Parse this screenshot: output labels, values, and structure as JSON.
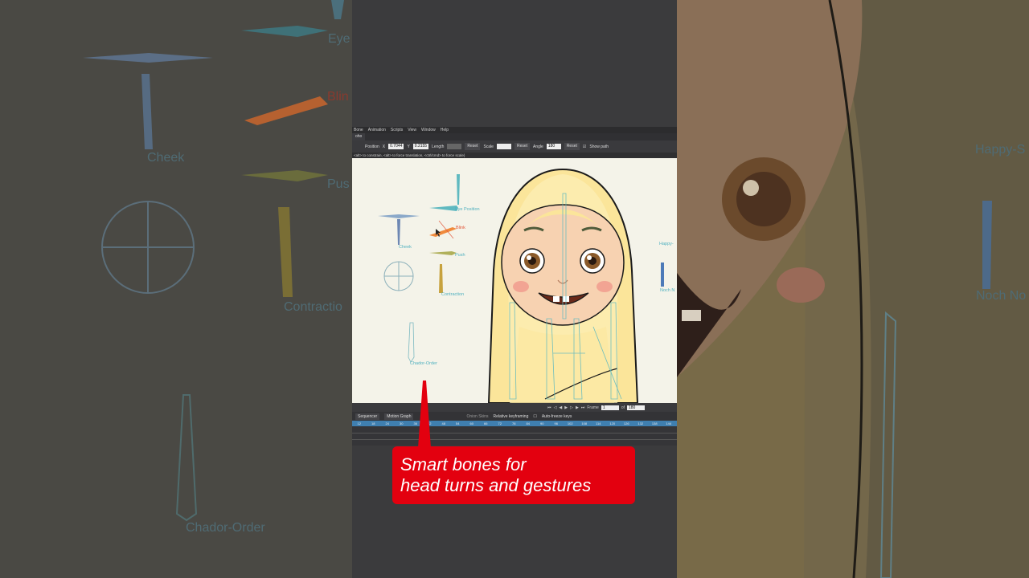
{
  "menu": [
    "Bone",
    "Animation",
    "Scripts",
    "View",
    "Window",
    "Help"
  ],
  "tab": "oho",
  "toolbar": {
    "position_label": "Position",
    "x_label": "X",
    "x_value": "0.7044",
    "y_label": "Y",
    "y_value": "0.2155",
    "length_label": "Length",
    "reset1": "Reset",
    "scale_label": "Scale",
    "reset2": "Reset",
    "angle_label": "Angle",
    "angle_value": "180",
    "reset3": "Reset",
    "show_path": "Show path"
  },
  "hint": "<alt> to constrain, <alt> to force translation, <ctrl/cmd> to force scale)",
  "bones": {
    "eye_position": "Eye Position",
    "blink": "Blink",
    "cheek": "Cheek",
    "push": "Push",
    "contraction": "Contraction",
    "chador_order": "Chador-Order",
    "happy": "Happy-",
    "noch": "Noch N"
  },
  "bg_left": {
    "eye": "Eye",
    "blink": "Blin",
    "cheek": "Cheek",
    "push": "Pus",
    "contraction": "Contractio",
    "chador": "Chador-Order"
  },
  "bg_right": {
    "happy": "Happy-S",
    "noch": "Noch No"
  },
  "playback": {
    "frame_label": "Frame",
    "frame_value": "1",
    "of_label": "of",
    "total": "180"
  },
  "timeline": {
    "sequencer": "Sequencer",
    "motion_graph": "Motion Graph",
    "dropdown": "Onion Skins",
    "relative": "Relative keyframing",
    "auto_freeze": "Auto-freeze keys",
    "ruler": [
      "12",
      "18",
      "24",
      "30",
      "36",
      "42",
      "48",
      "54",
      "60",
      "66",
      "72",
      "78",
      "84",
      "90",
      "96",
      "102",
      "108",
      "114",
      "120",
      "126",
      "132",
      "138",
      "144"
    ]
  },
  "callout": {
    "line1": "Smart bones for",
    "line2": "head turns and gestures"
  },
  "colors": {
    "callout": "#e3000f",
    "hair": "#fbe59a",
    "skin": "#f7d2b1",
    "bone_cyan": "#4fb0bf",
    "bone_orange": "#f08a3c"
  }
}
